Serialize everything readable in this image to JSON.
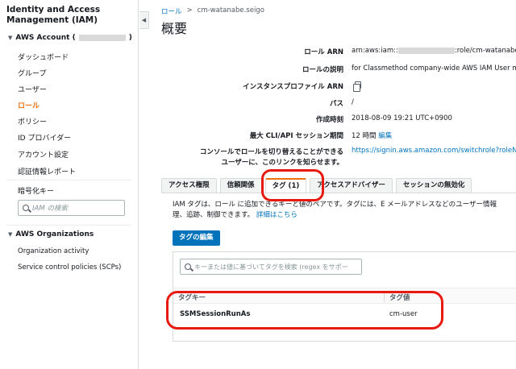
{
  "app": {
    "title": "Identity and Access Management (IAM)"
  },
  "sidebar": {
    "account_label": "AWS Account (",
    "account_close": ")",
    "items": [
      {
        "label": "ダッシュボード"
      },
      {
        "label": "グループ"
      },
      {
        "label": "ユーザー"
      },
      {
        "label": "ロール",
        "active": true
      },
      {
        "label": "ポリシー"
      },
      {
        "label": "ID プロバイダー"
      },
      {
        "label": "アカウント設定"
      },
      {
        "label": "認証情報レポート"
      }
    ],
    "encryption_label": "暗号化キー",
    "search_placeholder": "IAM の検索",
    "org_section": "AWS Organizations",
    "org_items": [
      {
        "label": "Organization activity"
      },
      {
        "label": "Service control policies (SCPs)"
      }
    ]
  },
  "breadcrumb": {
    "root": "ロール",
    "separator": ">",
    "current": "cm-watanabe.seigo"
  },
  "page_title": "概要",
  "summary": {
    "role_arn_label": "ロール ARN",
    "role_arn_prefix": "arn:aws:iam::",
    "role_arn_suffix": ":role/cm-watanabe.se",
    "description_label": "ロールの説明",
    "description_value": "for Classmethod company-wide AWS IAM User m",
    "instance_profile_label": "インスタンスプロファイル ARN",
    "path_label": "パス",
    "path_value": "/",
    "created_label": "作成時刻",
    "created_value": "2018-08-09 19:21 UTC+0900",
    "max_session_label": "最大 CLI/API セッション期間",
    "max_session_value": "12 時間",
    "max_session_edit": "編集",
    "switch_label_line1": "コンソールでロールを切り替えることができる",
    "switch_label_line2": "ユーザーに、このリンクを知らせます。",
    "switch_link": "https://signin.aws.amazon.com/switchrole?roleNa"
  },
  "tabs": [
    {
      "label": "アクセス権限"
    },
    {
      "label": "信頼関係"
    },
    {
      "label": "タグ (1)",
      "active": true
    },
    {
      "label": "アクセスアドバイザー"
    },
    {
      "label": "セッションの無効化"
    }
  ],
  "tags_tab": {
    "description": "IAM タグは、ロール に追加できるキーと値のペアです。タグには、E メールアドレスなどのユーザー情報",
    "description_line2": "理、追跡、制御できます。",
    "details_link": "詳細はこちら",
    "edit_button": "タグの編集",
    "search_placeholder": "キーまたは値に基づいてタグを検索 (regex をサポー",
    "columns": {
      "key": "タグキー",
      "value": "タグ値"
    },
    "rows": [
      {
        "key": "SSMSessionRunAs",
        "value": "cm-user"
      }
    ]
  },
  "colors": {
    "accent": "#ec7211",
    "link": "#0073bb",
    "highlight": "#e8190f"
  }
}
